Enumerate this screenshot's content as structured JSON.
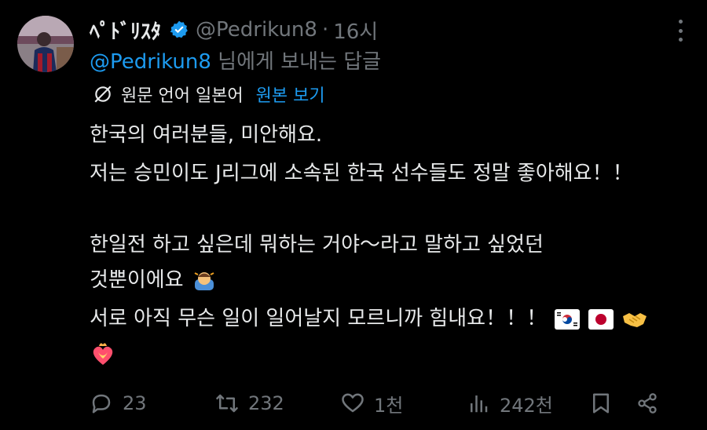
{
  "author": {
    "name": "ﾍﾟﾄﾞﾘｽﾀ",
    "handle": "@Pedrikun8",
    "time": "16시"
  },
  "reply": {
    "mention": "@Pedrikun8",
    "suffix": " 님에게 보내는 답글"
  },
  "translation": {
    "label": "원문 언어 일본어",
    "link": "원본 보기"
  },
  "body": {
    "line1": "한국의 여러분들, 미안해요.",
    "line2": "저는 승민이도 J리그에 소속된 한국 선수들도 정말 좋아해요！！",
    "line3": "한일전 하고 싶은데 뭐하는 거야～라고 말하고 싶었던",
    "line4": "것뿐이에요",
    "line5": "서로 아직 무슨 일이 일어날지 모르니까 힘내요！！！"
  },
  "actions": {
    "replies": "23",
    "retweets": "232",
    "likes": "1천",
    "views": "242천"
  },
  "icons": {
    "verified": "verified-badge-icon",
    "more": "more-dots-icon",
    "translate": "translate-icon",
    "reply": "reply-icon",
    "retweet": "retweet-icon",
    "like": "heart-icon",
    "views": "views-icon",
    "bookmark": "bookmark-icon",
    "share": "share-icon"
  },
  "colors": {
    "background": "#000000",
    "text": "#e7e9ea",
    "muted": "#71767b",
    "accent": "#1d9bf0"
  }
}
